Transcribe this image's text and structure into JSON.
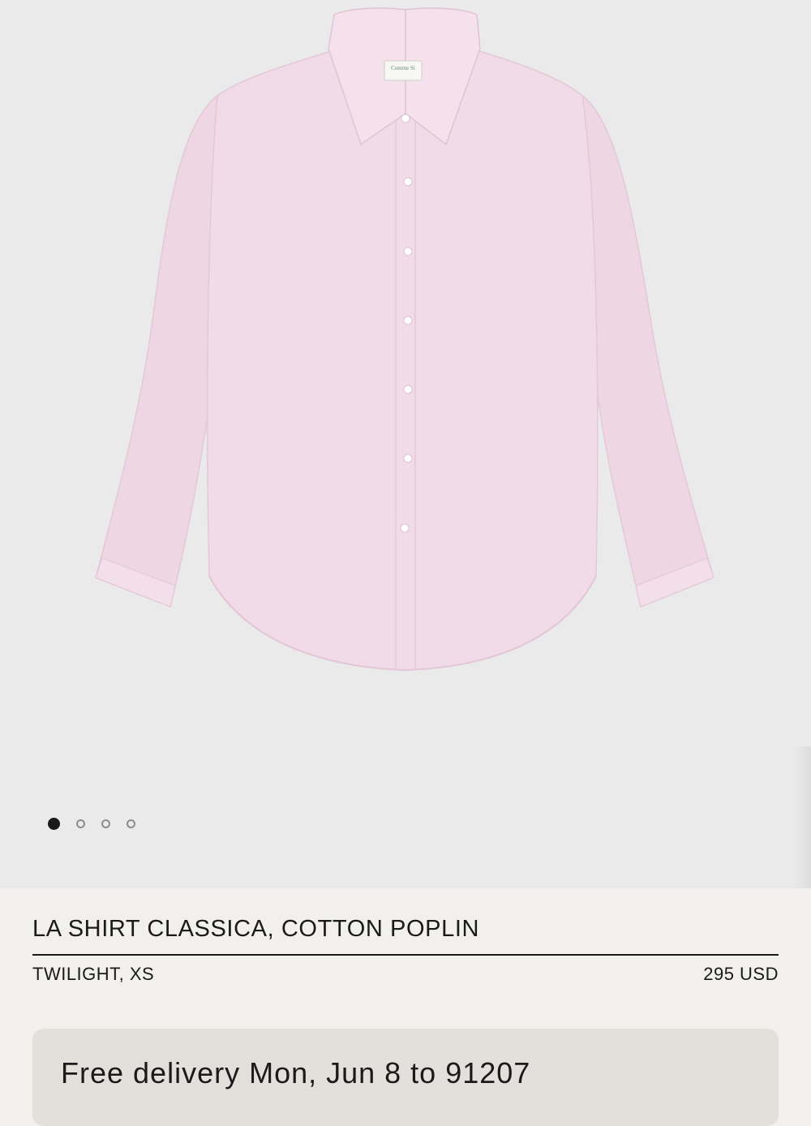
{
  "gallery": {
    "image_alt": "Pink long-sleeve cotton poplin shirt",
    "label_text": "Comme Si",
    "slide_count": 4,
    "active_slide": 1
  },
  "product": {
    "title": "LA SHIRT CLASSICA, COTTON POPLIN",
    "variant": "TWILIGHT, XS",
    "price": "295 USD"
  },
  "delivery": {
    "text": "Free delivery Mon, Jun 8 to 91207"
  },
  "colors": {
    "background": "#f2f0ec",
    "gallery_bg": "#eaeaea",
    "shirt": "#f0d9e6",
    "card": "#e3e0dc"
  }
}
